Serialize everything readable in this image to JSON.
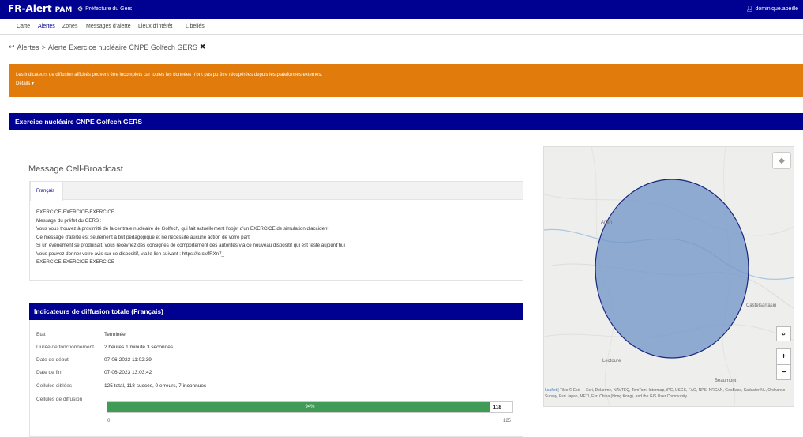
{
  "header": {
    "brand_fr": "FR-Alert",
    "brand_pam": "PAM",
    "prefecture": "Préfecture du Gers",
    "user": "dominique.abeille"
  },
  "nav": {
    "items": [
      "Carte",
      "Alertes",
      "Zones",
      "Messages d'alerte",
      "Lieux d'intérêt",
      "Libellés"
    ],
    "active": "Alertes"
  },
  "breadcrumb": {
    "root": "Alertes",
    "separator": ">",
    "level1": "Alerte",
    "current": "Exercice nucléaire CNPE Golfech GERS"
  },
  "warning": {
    "message": "Les indicateurs de diffusion affichés peuvent être incomplets car toutes les données n'ont pas pu être récupérées depuis les plateformes externes.",
    "details_label": "Détails ▾"
  },
  "alert_title": "Exercice nucléaire CNPE Golfech GERS",
  "cell_broadcast": {
    "title": "Message Cell-Broadcast",
    "tab_label": "Français",
    "lines": [
      "EXERCICE-EXERCICE-EXERCICE",
      "Message du préfet du GERS :",
      "Vous vous trouvez à proximité de la centrale nucléaire de Golfech, qui fait actuellement l'objet d'un EXERCICE de simulation d'accident",
      "Ce message d'alerte est seulement à but pédagogique et ne nécessite aucune action de votre part",
      "Si un événement se produisait, vous recevriez des consignes de comportement des autorités via ce nouveau dispositif qui est testé aujourd'hui",
      "Vous pouvez donner votre avis sur ce dispositif, via le lien suivant : https://lc.cx/fRXn7_",
      "EXERCICE-EXERCICE-EXERCICE"
    ]
  },
  "indicators": {
    "title": "Indicateurs de diffusion totale (Français)",
    "rows": [
      {
        "label": "Etat",
        "value": "Terminée"
      },
      {
        "label": "Durée de fonctionnement",
        "value": "2 heures 1 minute 3 secondes"
      },
      {
        "label": "Date de début",
        "value": "07-06-2023 11:02:39"
      },
      {
        "label": "Date de fin",
        "value": "07-06-2023 13:03:42"
      },
      {
        "label": "Cellules ciblées",
        "value": "125 total, 118 succès, 0 erreurs, 7 inconnues"
      },
      {
        "label": "Cellules de diffusion",
        "value": ""
      }
    ],
    "progress": {
      "center_label": "94%",
      "count": "118",
      "fraction": 0.944,
      "min": "0",
      "max": "125",
      "color": "#3f9b55"
    }
  },
  "map": {
    "labels": [
      "Agen",
      "Castelsarrasin",
      "Lectoure",
      "Beaumont"
    ],
    "circle_fill": "#6f93c8",
    "circle_stroke": "#1a2680",
    "attribution_link": "Leaflet",
    "attribution_text": "| Tiles © Esri — Esri, DeLorme, NAVTEQ, TomTom, Intermap, iPC, USGS, FAO, NPS, NRCAN, GeoBase, Kadaster NL, Ordnance Survey, Esri Japan, METI, Esri China (Hong Kong), and the GIS User Community",
    "zoom_in": "+",
    "zoom_out": "−"
  },
  "colors": {
    "primary": "#000091",
    "warning": "#e07b0c",
    "success": "#3f9b55"
  }
}
